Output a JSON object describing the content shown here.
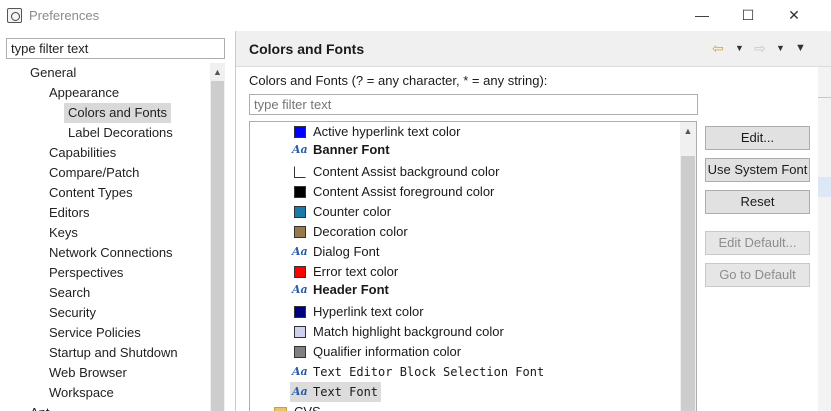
{
  "window": {
    "title": "Preferences",
    "minimize": "—",
    "maximize": "☐",
    "close": "✕"
  },
  "sidebar": {
    "filter_value": "type filter text",
    "items": [
      {
        "label": "General"
      },
      {
        "label": "Appearance"
      },
      {
        "label": "Colors and Fonts"
      },
      {
        "label": "Label Decorations"
      },
      {
        "label": "Capabilities"
      },
      {
        "label": "Compare/Patch"
      },
      {
        "label": "Content Types"
      },
      {
        "label": "Editors"
      },
      {
        "label": "Keys"
      },
      {
        "label": "Network Connections"
      },
      {
        "label": "Perspectives"
      },
      {
        "label": "Search"
      },
      {
        "label": "Security"
      },
      {
        "label": "Service Policies"
      },
      {
        "label": "Startup and Shutdown"
      },
      {
        "label": "Web Browser"
      },
      {
        "label": "Workspace"
      },
      {
        "label": "Ant"
      }
    ],
    "scroll_up": "▲"
  },
  "page": {
    "title": "Colors and Fonts",
    "description": "Colors and Fonts (? = any character, * = any string):",
    "filter_placeholder": "type filter text",
    "nav_back": "⇦",
    "nav_forward": "⇨",
    "nav_dropdown": "▼",
    "menu_dropdown": "▼"
  },
  "entries": [
    {
      "label": "Active hyperlink text color",
      "kind": "color",
      "color": "#0000ff"
    },
    {
      "label": "Banner Font",
      "kind": "font",
      "style": "bold"
    },
    {
      "label": "Content Assist background color",
      "kind": "color",
      "color": "#ffffff"
    },
    {
      "label": "Content Assist foreground color",
      "kind": "color",
      "color": "#000000"
    },
    {
      "label": "Counter color",
      "kind": "color",
      "color": "#1b7aa8"
    },
    {
      "label": "Decoration color",
      "kind": "color",
      "color": "#967a4b"
    },
    {
      "label": "Dialog Font",
      "kind": "font",
      "style": "normal"
    },
    {
      "label": "Error text color",
      "kind": "color",
      "color": "#ff0000"
    },
    {
      "label": "Header Font",
      "kind": "font",
      "style": "bold"
    },
    {
      "label": "Hyperlink text color",
      "kind": "color",
      "color": "#000080"
    },
    {
      "label": "Match highlight background color",
      "kind": "color",
      "color": "#cfcfef"
    },
    {
      "label": "Qualifier information color",
      "kind": "color",
      "color": "#808080"
    },
    {
      "label": "Text Editor Block Selection Font",
      "kind": "font",
      "style": "mono"
    },
    {
      "label": "Text Font",
      "kind": "font",
      "style": "mono",
      "selected": true
    },
    {
      "label": "CVS",
      "kind": "folder"
    }
  ],
  "aa_glyph": "Aa",
  "list_scroll_up": "▲",
  "buttons": {
    "edit": "Edit...",
    "use_system_font": "Use System Font",
    "reset": "Reset",
    "edit_default": "Edit Default...",
    "go_to_default": "Go to Default"
  }
}
